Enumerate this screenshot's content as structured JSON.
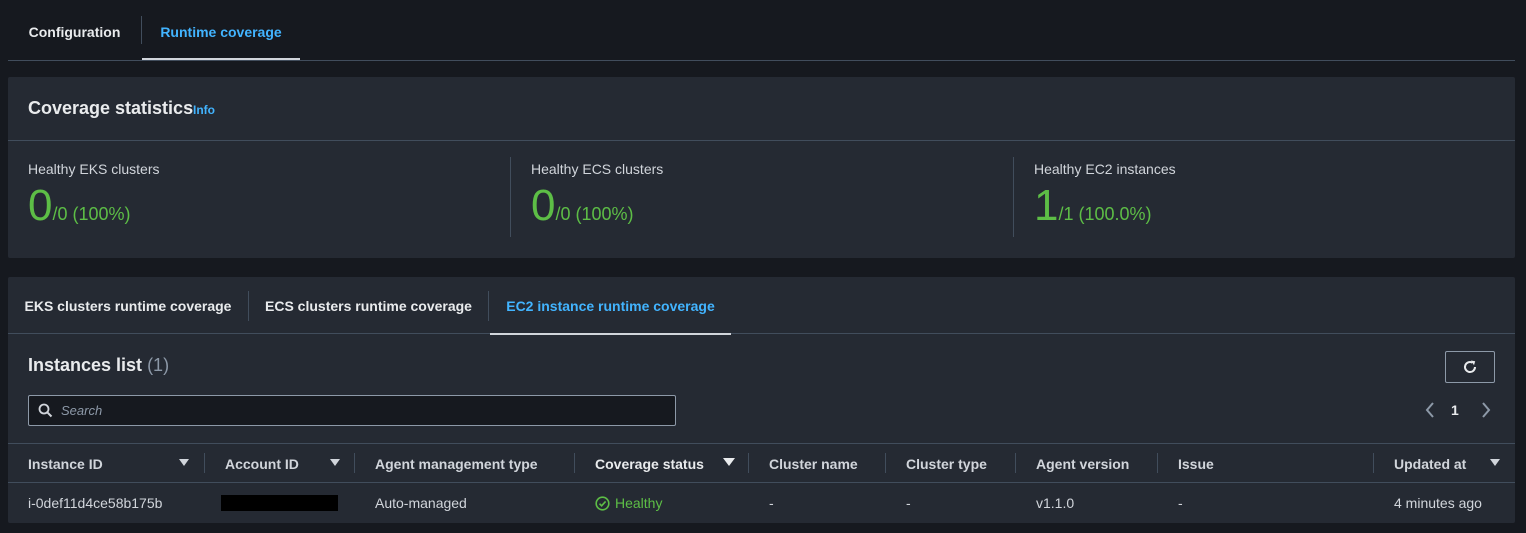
{
  "top_tabs": [
    {
      "label": "Configuration",
      "active": false
    },
    {
      "label": "Runtime coverage",
      "active": true
    }
  ],
  "stats": {
    "title": "Coverage statistics",
    "info": "Info",
    "items": [
      {
        "label": "Healthy EKS clusters",
        "healthy": "0",
        "rest": "/0 (100%)"
      },
      {
        "label": "Healthy ECS clusters",
        "healthy": "0",
        "rest": "/0 (100%)"
      },
      {
        "label": "Healthy EC2 instances",
        "healthy": "1",
        "rest": "/1 (100.0%)"
      }
    ],
    "color_healthy": "#5dbe46"
  },
  "coverage": {
    "tabs": [
      {
        "label": "EKS clusters runtime coverage",
        "active": false
      },
      {
        "label": "ECS clusters runtime coverage",
        "active": false
      },
      {
        "label": "EC2 instance runtime coverage",
        "active": true
      }
    ],
    "list_title": "Instances list",
    "list_count": "(1)",
    "refresh_icon": "refresh-icon",
    "search": {
      "placeholder": "Search",
      "value": ""
    },
    "pagination": {
      "current_page": "1"
    },
    "columns": [
      {
        "label": "Instance ID",
        "sortable": true
      },
      {
        "label": "Account ID",
        "sortable": true
      },
      {
        "label": "Agent management type",
        "sortable": false
      },
      {
        "label": "Coverage status",
        "sortable": true,
        "sorted": true
      },
      {
        "label": "Cluster name",
        "sortable": false
      },
      {
        "label": "Cluster type",
        "sortable": false
      },
      {
        "label": "Agent version",
        "sortable": false
      },
      {
        "label": "Issue",
        "sortable": false
      },
      {
        "label": "Updated at",
        "sortable": true
      }
    ],
    "rows": [
      {
        "instance_id": "i-0def11d4ce58b175b",
        "account_id": "",
        "agent_management_type": "Auto-managed",
        "coverage_status": "Healthy",
        "cluster_name": "-",
        "cluster_type": "-",
        "agent_version": "v1.1.0",
        "issue": "-",
        "updated_at": "4 minutes ago"
      }
    ]
  }
}
